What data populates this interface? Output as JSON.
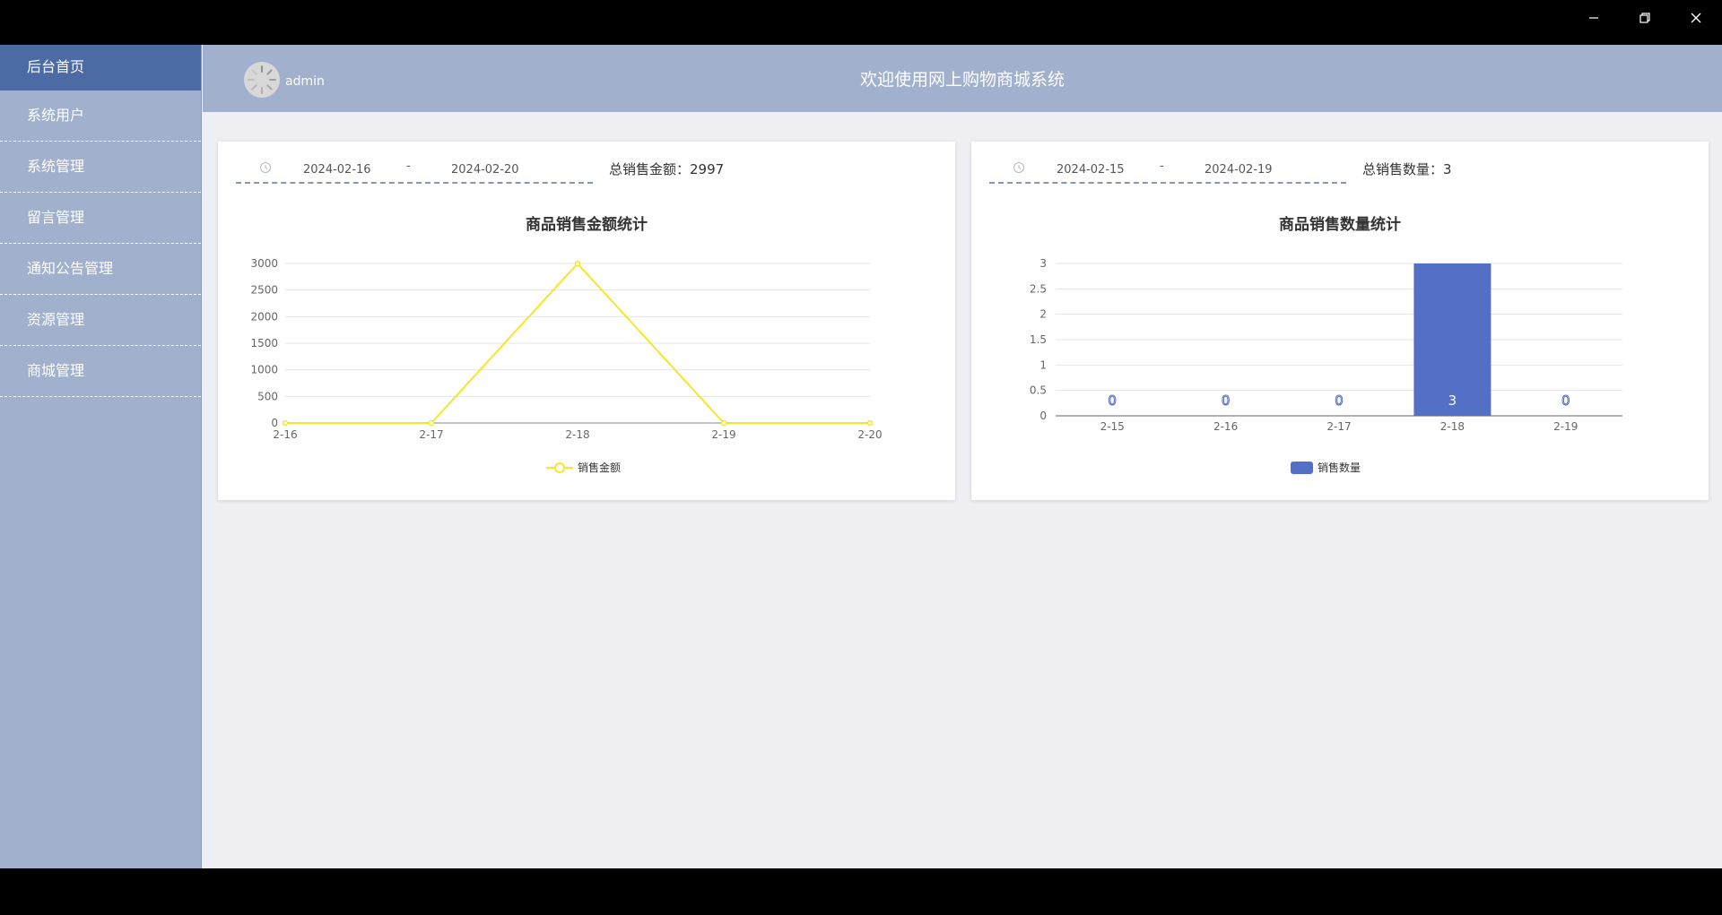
{
  "sidebar": {
    "items": [
      {
        "label": "后台首页",
        "active": true
      },
      {
        "label": "系统用户"
      },
      {
        "label": "系统管理"
      },
      {
        "label": "留言管理"
      },
      {
        "label": "通知公告管理"
      },
      {
        "label": "资源管理"
      },
      {
        "label": "商城管理"
      }
    ]
  },
  "header": {
    "username": "admin",
    "title": "欢迎使用网上购物商城系统"
  },
  "colors": {
    "sidebar": "#a1b0cc",
    "sidebar_active": "#4c6aa3",
    "line": "#f5e62a",
    "bar": "#5470c6"
  },
  "left_card": {
    "start_date": "2024-02-16",
    "separator": "-",
    "end_date": "2024-02-20",
    "total_label": "总销售金额：",
    "total_value": "2997"
  },
  "right_card": {
    "start_date": "2024-02-15",
    "separator": "-",
    "end_date": "2024-02-19",
    "total_label": "总销售数量：",
    "total_value": "3"
  },
  "chart_data": [
    {
      "type": "line",
      "title": "商品销售金额统计",
      "categories": [
        "2-16",
        "2-17",
        "2-18",
        "2-19",
        "2-20"
      ],
      "series": [
        {
          "name": "销售金额",
          "values": [
            0,
            0,
            2997,
            0,
            0
          ]
        }
      ],
      "ylim": [
        0,
        3000
      ],
      "yticks": [
        "0",
        "500",
        "1000",
        "1500",
        "2000",
        "2500",
        "3000"
      ],
      "grid": true,
      "legend": "bottom-center"
    },
    {
      "type": "bar",
      "title": "商品销售数量统计",
      "categories": [
        "2-15",
        "2-16",
        "2-17",
        "2-18",
        "2-19"
      ],
      "series": [
        {
          "name": "销售数量",
          "values": [
            0,
            0,
            0,
            3,
            0
          ]
        }
      ],
      "ylim": [
        0,
        3
      ],
      "yticks": [
        "0",
        "0.5",
        "1",
        "1.5",
        "2",
        "2.5",
        "3"
      ],
      "grid": true,
      "legend": "bottom-center",
      "data_labels": [
        "0",
        "0",
        "0",
        "3",
        "0"
      ]
    }
  ]
}
